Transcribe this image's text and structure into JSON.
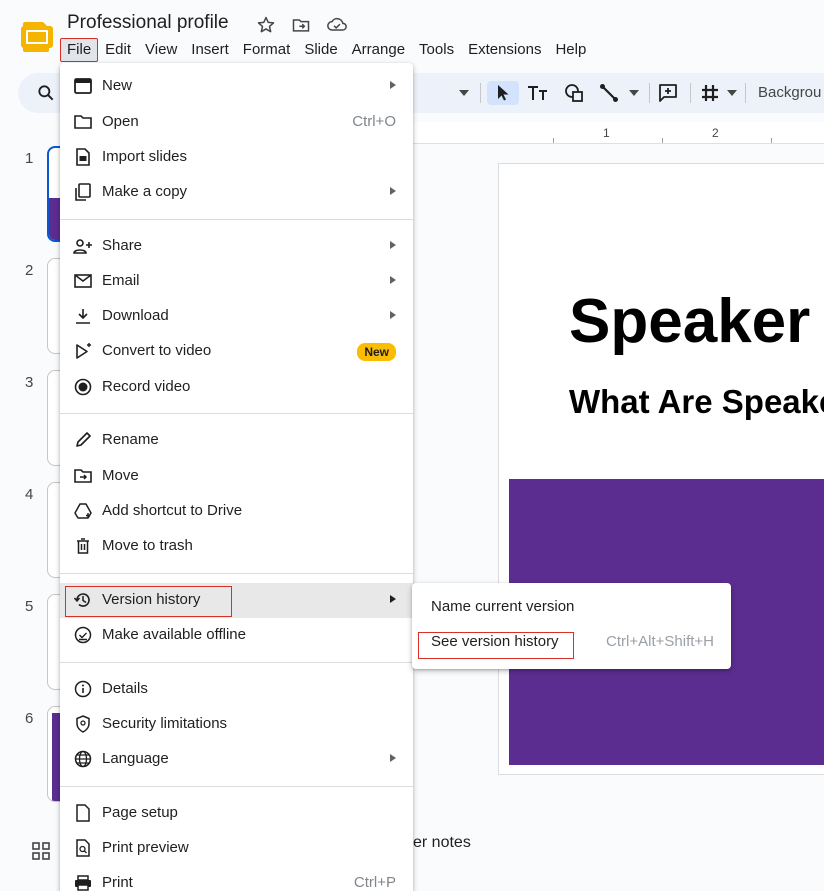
{
  "app": {
    "title": "Professional profile",
    "logo_icon": "slides-logo-icon",
    "star_icon": "star-icon",
    "move_icon": "move-folder-icon",
    "cloud_icon": "cloud-saved-icon"
  },
  "menubar": {
    "items": [
      {
        "label": "File",
        "active": true
      },
      {
        "label": "Edit"
      },
      {
        "label": "View"
      },
      {
        "label": "Insert"
      },
      {
        "label": "Format"
      },
      {
        "label": "Slide"
      },
      {
        "label": "Arrange"
      },
      {
        "label": "Tools"
      },
      {
        "label": "Extensions"
      },
      {
        "label": "Help"
      }
    ]
  },
  "toolbar": {
    "background_label": "Backgrou",
    "icons": [
      "search-icon",
      "select-pointer-icon",
      "text-box-icon",
      "shape-icon",
      "line-icon",
      "comment-icon",
      "layout-grid-icon"
    ]
  },
  "filmstrip": {
    "slides": [
      {
        "num": "1",
        "selected": true
      },
      {
        "num": "2"
      },
      {
        "num": "3"
      },
      {
        "num": "4"
      },
      {
        "num": "5"
      },
      {
        "num": "6"
      }
    ]
  },
  "ruler": {
    "marks": [
      "1",
      "2"
    ]
  },
  "slide": {
    "title": "Speaker",
    "subtitle": "What Are Speake",
    "accent_color": "#5c2d91"
  },
  "notes": {
    "label": "er notes"
  },
  "file_menu": {
    "items": [
      {
        "label": "New",
        "icon": "new-presentation-icon",
        "submenu": true
      },
      {
        "label": "Open",
        "icon": "folder-open-icon",
        "shortcut": "Ctrl+O"
      },
      {
        "label": "Import slides",
        "icon": "import-slides-icon"
      },
      {
        "label": "Make a copy",
        "icon": "copy-icon",
        "submenu": true
      },
      {
        "label": "Share",
        "icon": "share-person-icon",
        "submenu": true
      },
      {
        "label": "Email",
        "icon": "email-icon",
        "submenu": true
      },
      {
        "label": "Download",
        "icon": "download-icon",
        "submenu": true
      },
      {
        "label": "Convert to video",
        "icon": "convert-video-icon",
        "badge": "New"
      },
      {
        "label": "Record video",
        "icon": "record-icon"
      },
      {
        "label": "Rename",
        "icon": "pencil-icon"
      },
      {
        "label": "Move",
        "icon": "move-icon"
      },
      {
        "label": "Add shortcut to Drive",
        "icon": "drive-shortcut-icon"
      },
      {
        "label": "Move to trash",
        "icon": "trash-icon"
      },
      {
        "label": "Version history",
        "icon": "history-icon",
        "submenu": true,
        "highlighted": true
      },
      {
        "label": "Make available offline",
        "icon": "offline-icon"
      },
      {
        "label": "Details",
        "icon": "info-icon"
      },
      {
        "label": "Security limitations",
        "icon": "security-icon"
      },
      {
        "label": "Language",
        "icon": "globe-icon",
        "submenu": true
      },
      {
        "label": "Page setup",
        "icon": "page-setup-icon"
      },
      {
        "label": "Print preview",
        "icon": "print-preview-icon"
      },
      {
        "label": "Print",
        "icon": "print-icon",
        "shortcut": "Ctrl+P"
      }
    ]
  },
  "version_submenu": {
    "items": [
      {
        "label": "Name current version"
      },
      {
        "label": "See version history",
        "shortcut": "Ctrl+Alt+Shift+H"
      }
    ]
  }
}
